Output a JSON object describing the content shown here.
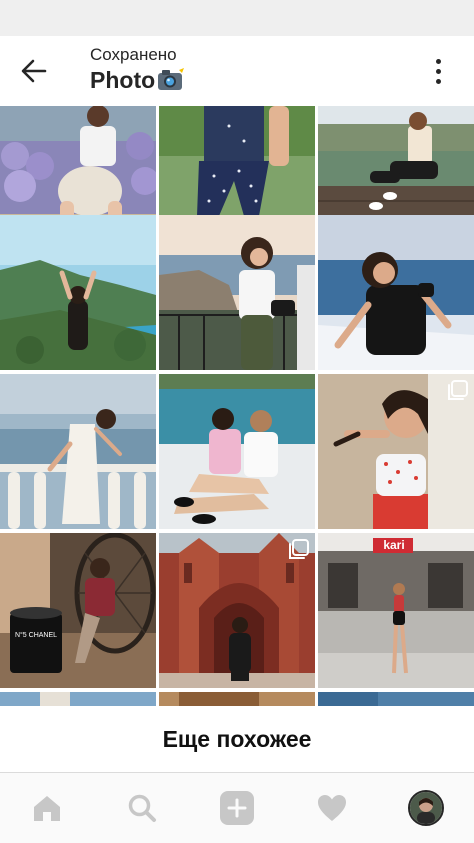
{
  "header": {
    "subtitle": "Сохранено",
    "title": "Photo",
    "title_emoji": "📸",
    "back_icon": "arrow-left-icon",
    "more_icon": "vertical-dots-icon"
  },
  "grid": {
    "tiles": [
      {
        "name": "lavender-field-photo",
        "multi": false
      },
      {
        "name": "polka-dot-pants-photo",
        "multi": false
      },
      {
        "name": "waterfront-pier-photo",
        "multi": false
      },
      {
        "name": "coastal-hills-photo",
        "multi": false
      },
      {
        "name": "seaside-balcony-photo",
        "multi": false
      },
      {
        "name": "sea-rocks-photo",
        "multi": false
      },
      {
        "name": "balustrade-sunset-photo",
        "multi": false
      },
      {
        "name": "poolside-friends-photo",
        "multi": false
      },
      {
        "name": "smiling-girl-photo",
        "multi": true
      },
      {
        "name": "chanel-cafe-photo",
        "multi": false
      },
      {
        "name": "red-cathedral-photo",
        "multi": true
      },
      {
        "name": "shopping-mall-photo",
        "multi": false
      }
    ],
    "mall_sign": "kari",
    "chanel_text": "N°5 CHANEL"
  },
  "more_section": {
    "label": "Еще похожее"
  },
  "bottom_nav": {
    "items": [
      "home-icon",
      "search-icon",
      "add-icon",
      "heart-icon",
      "profile-avatar"
    ]
  },
  "colors": {
    "header_bg": "#ffffff",
    "status_bar_bg": "#efefef",
    "nav_bg": "#fafafa",
    "nav_icon": "#c7c7c7",
    "text": "#262626"
  }
}
